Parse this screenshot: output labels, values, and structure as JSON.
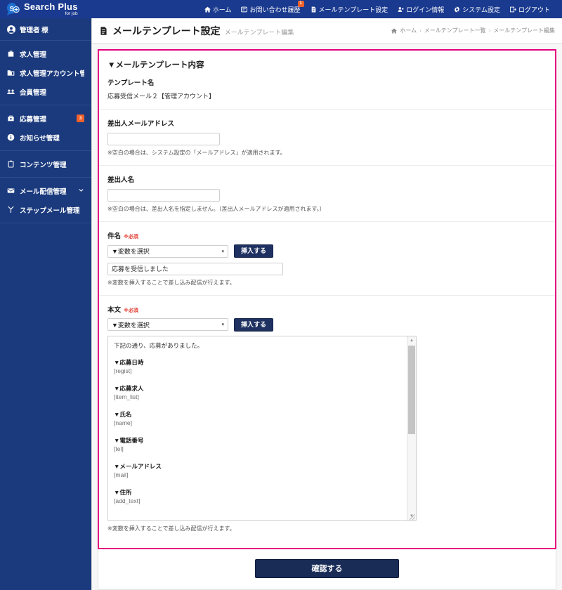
{
  "brand": {
    "logo_main": "Search Plus",
    "logo_sub": "for job",
    "logo_icon": "search-plus-logo-icon",
    "header_color": "#1a3a8f",
    "sidebar_color": "#1b3a7d",
    "accent_color": "#e4007f",
    "badge_color": "#f0612b",
    "button_color": "#192c56"
  },
  "topnav": {
    "items": [
      {
        "label": "ホーム",
        "icon": "home-icon",
        "badge": ""
      },
      {
        "label": "お問い合わせ履歴",
        "icon": "inbox-icon",
        "badge": "1"
      },
      {
        "label": "メールテンプレート設定",
        "icon": "document-icon",
        "badge": ""
      },
      {
        "label": "ログイン情報",
        "icon": "user-group-icon",
        "badge": ""
      },
      {
        "label": "システム設定",
        "icon": "gear-icon",
        "badge": ""
      },
      {
        "label": "ログアウト",
        "icon": "logout-icon",
        "badge": ""
      }
    ]
  },
  "sidebar": {
    "user_label": "管理者 様",
    "user_icon": "account-circle-icon",
    "groups": [
      {
        "items": [
          {
            "label": "求人管理",
            "icon": "briefcase-icon",
            "badge": "",
            "chevron": false
          },
          {
            "label": "求人管理アカウント管理",
            "icon": "folder-icon",
            "badge": "",
            "chevron": false
          },
          {
            "label": "会員管理",
            "icon": "people-icon",
            "badge": "",
            "chevron": false
          }
        ]
      },
      {
        "items": [
          {
            "label": "応募管理",
            "icon": "application-icon",
            "badge": "3",
            "chevron": false
          },
          {
            "label": "お知らせ管理",
            "icon": "info-icon",
            "badge": "",
            "chevron": false
          }
        ]
      },
      {
        "items": [
          {
            "label": "コンテンツ管理",
            "icon": "clipboard-icon",
            "badge": "",
            "chevron": false
          }
        ]
      },
      {
        "items": [
          {
            "label": "メール配信管理",
            "icon": "mail-icon",
            "badge": "",
            "chevron": true
          },
          {
            "label": "ステップメール管理",
            "icon": "branch-icon",
            "badge": "",
            "chevron": false
          }
        ]
      }
    ]
  },
  "page": {
    "title_icon": "document-icon",
    "title": "メールテンプレート設定",
    "subtitle": "メールテンプレート編集",
    "breadcrumb": {
      "home_icon": "home-icon",
      "items": [
        "ホーム",
        "メールテンプレート一覧",
        "メールテンプレート編集"
      ],
      "separator": "›"
    }
  },
  "form": {
    "panel_title": "▼メールテンプレート内容",
    "template_name": {
      "label": "テンプレート名",
      "value": "応募受信メール２【管理アカウント】"
    },
    "sender_email": {
      "label": "差出人メールアドレス",
      "value": "",
      "note": "※空白の場合は、システム設定の「メールアドレス」が適用されます。"
    },
    "sender_name": {
      "label": "差出人名",
      "value": "",
      "note": "※空白の場合は、差出人名を指定しません。（差出人メールアドレスが適用されます。）"
    },
    "subject": {
      "label": "件名",
      "required_mark": "※必須",
      "variable_select": "▼変数を選択",
      "insert_button": "挿入する",
      "value": "応募を受信しました",
      "note": "※変数を挿入することで差し込み配信が行えます。"
    },
    "body": {
      "label": "本文",
      "required_mark": "※必須",
      "variable_select": "▼変数を選択",
      "insert_button": "挿入する",
      "intro": "下記の通り、応募がありました。",
      "entries": [
        {
          "heading": "▼応募日時",
          "variable": "[regist]"
        },
        {
          "heading": "▼応募求人",
          "variable": "[item_list]"
        },
        {
          "heading": "▼氏名",
          "variable": "[name]"
        },
        {
          "heading": "▼電話番号",
          "variable": "[tel]"
        },
        {
          "heading": "▼メールアドレス",
          "variable": "[mail]"
        },
        {
          "heading": "▼住所",
          "variable": "[add_text]"
        }
      ],
      "note": "※変数を挿入することで差し込み配信が行えます。"
    },
    "submit_button": "確認する"
  }
}
